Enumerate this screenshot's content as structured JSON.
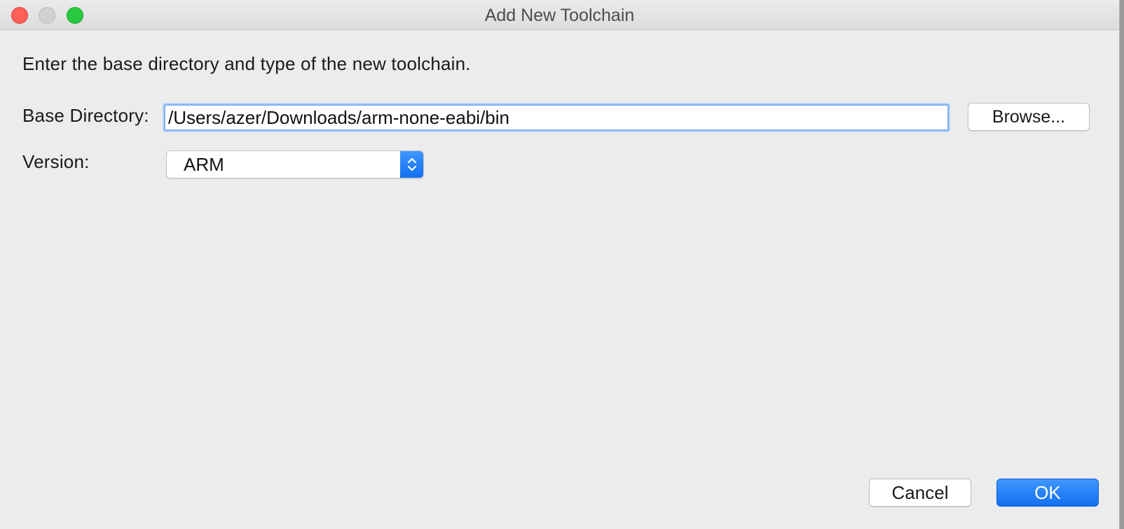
{
  "window": {
    "title": "Add New Toolchain"
  },
  "dialog": {
    "description": "Enter the base directory and type of the new toolchain.",
    "base_directory": {
      "label": "Base Directory:",
      "value": "/Users/azer/Downloads/arm-none-eabi/bin"
    },
    "browse_label": "Browse...",
    "version": {
      "label": "Version:",
      "selected": "ARM"
    },
    "cancel_label": "Cancel",
    "ok_label": "OK"
  },
  "colors": {
    "accent": "#1a7cf5",
    "close": "#fe5f57",
    "minimize": "#d0d0d0",
    "maximize": "#28c840"
  },
  "icons": {
    "select": "chevron-up-down-icon"
  }
}
